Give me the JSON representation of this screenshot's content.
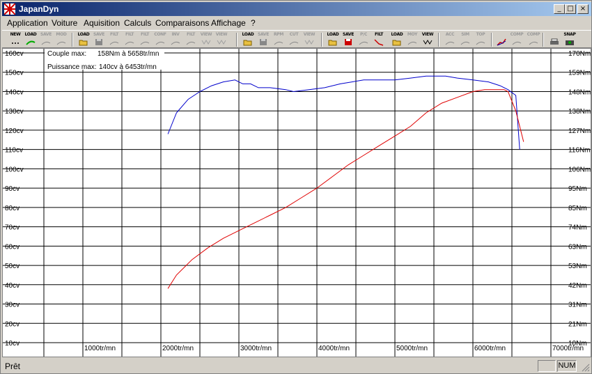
{
  "window": {
    "title": "JapanDyn"
  },
  "title_buttons": {
    "minimize": "_",
    "maximize": "□",
    "close": "×"
  },
  "menu": [
    "Application",
    "Voiture",
    "Aquisition",
    "Calculs",
    "Comparaisons",
    "Affichage",
    "?"
  ],
  "toolbar": [
    {
      "label": "NEW",
      "icon": "dots-icon",
      "enabled": true
    },
    {
      "label": "LOAD",
      "icon": "curve-load-icon",
      "enabled": true
    },
    {
      "label": "SAVE",
      "icon": "curve-save-icon",
      "enabled": false
    },
    {
      "label": "MOD",
      "icon": "curve-mod-icon",
      "enabled": false
    },
    {
      "label": "LOAD",
      "icon": "folder-icon",
      "enabled": true
    },
    {
      "label": "SAVE",
      "icon": "floppy-icon",
      "enabled": false
    },
    {
      "label": "FILT",
      "icon": "filter-off-icon",
      "enabled": false
    },
    {
      "label": "FILT",
      "icon": "filter-plus-icon",
      "enabled": false
    },
    {
      "label": "FILT",
      "icon": "filter-minus-icon",
      "enabled": false
    },
    {
      "label": "CONF",
      "icon": "config-icon",
      "enabled": false
    },
    {
      "label": "INV",
      "icon": "invert-icon",
      "enabled": false
    },
    {
      "label": "FILT",
      "icon": "filter-s-icon",
      "enabled": false
    },
    {
      "label": "VIEW",
      "icon": "view-icon",
      "enabled": false
    },
    {
      "label": "VIEW",
      "icon": "view-icon",
      "enabled": false
    },
    {
      "label": "LOAD",
      "icon": "folder-icon",
      "enabled": true
    },
    {
      "label": "SAVE",
      "icon": "floppy-icon",
      "enabled": false
    },
    {
      "label": "RPM",
      "icon": "rpm-icon",
      "enabled": false
    },
    {
      "label": "CUT",
      "icon": "scissors-icon",
      "enabled": false
    },
    {
      "label": "VIEW",
      "icon": "view-icon",
      "enabled": false
    },
    {
      "label": "LOAD",
      "icon": "folder-icon",
      "enabled": true
    },
    {
      "label": "SAVE",
      "icon": "floppy-red-icon",
      "enabled": true
    },
    {
      "label": "P/C",
      "icon": "pc-icon",
      "enabled": false
    },
    {
      "label": "FILT",
      "icon": "filter-icon",
      "enabled": true
    },
    {
      "label": "LOAD",
      "icon": "folder-icon",
      "enabled": true
    },
    {
      "label": "MOY",
      "icon": "average-icon",
      "enabled": false
    },
    {
      "label": "VIEW",
      "icon": "view-icon",
      "enabled": true
    },
    {
      "label": "ACC",
      "icon": "acc-icon",
      "enabled": false
    },
    {
      "label": "SIM",
      "icon": "sim-icon",
      "enabled": false
    },
    {
      "label": "TOP",
      "icon": "top-icon",
      "enabled": false
    },
    {
      "label": "",
      "icon": "graph-icon",
      "enabled": true
    },
    {
      "label": "COMP",
      "icon": "comp-icon",
      "enabled": false
    },
    {
      "label": "COMP",
      "icon": "comp-icon",
      "enabled": false
    },
    {
      "label": "",
      "icon": "printer-icon",
      "enabled": true
    },
    {
      "label": "SNAP",
      "icon": "camera-icon",
      "enabled": true
    }
  ],
  "plot": {
    "info_torque_label": "Couple max:",
    "info_torque_value": "158Nm à 5658tr/mn",
    "info_power_label": "Puissance max:",
    "info_power_value": "140cv à 6453tr/mn",
    "colors": {
      "power": "#0000cc",
      "torque": "#e00000",
      "grid": "#000000"
    }
  },
  "chart_data": {
    "type": "line",
    "x_range": [
      1000,
      7000
    ],
    "left_axis": {
      "unit": "cv",
      "range": [
        10,
        160
      ],
      "ticks": [
        "10cv",
        "20cv",
        "30cv",
        "40cv",
        "50cv",
        "60cv",
        "70cv",
        "80cv",
        "90cv",
        "100cv",
        "110cv",
        "120cv",
        "130cv",
        "140cv",
        "150cv",
        "160cv"
      ]
    },
    "right_axis": {
      "unit": "Nm",
      "range": [
        10,
        170
      ],
      "ticks": [
        "10Nm",
        "21Nm",
        "31Nm",
        "42Nm",
        "53Nm",
        "63Nm",
        "74Nm",
        "85Nm",
        "95Nm",
        "106Nm",
        "116Nm",
        "127Nm",
        "138Nm",
        "148Nm",
        "159Nm",
        "170Nm"
      ]
    },
    "x_ticks": [
      "1000tr/mn",
      "2000tr/mn",
      "3000tr/mn",
      "4000tr/mn",
      "5000tr/mn",
      "6000tr/mn",
      "7000tr/mn"
    ],
    "series": [
      {
        "key": "power_series",
        "axis": "left",
        "color": "#0000cc",
        "x": [
          2090,
          2200,
          2350,
          2500,
          2650,
          2800,
          2950,
          3050,
          3150,
          3250,
          3400,
          3600,
          3700,
          3900,
          4100,
          4300,
          4450,
          4600,
          4800,
          5000,
          5200,
          5400,
          5500,
          5650,
          5800,
          6000,
          6200,
          6350,
          6450,
          6550,
          6600
        ],
        "y": [
          118,
          129,
          136,
          140,
          143,
          145,
          146,
          144,
          144,
          142,
          142,
          141,
          140,
          141,
          142,
          144,
          145,
          146,
          146,
          146,
          147,
          148,
          148,
          148,
          147,
          146,
          145,
          143,
          141,
          138,
          110
        ]
      },
      {
        "key": "torque_series",
        "axis": "left",
        "color": "#e00000",
        "x": [
          2090,
          2200,
          2400,
          2600,
          2800,
          3000,
          3200,
          3400,
          3600,
          3800,
          4000,
          4200,
          4400,
          4600,
          4800,
          5000,
          5200,
          5400,
          5600,
          5800,
          6000,
          6150,
          6300,
          6400,
          6450,
          6550,
          6650
        ],
        "y": [
          38,
          45,
          53,
          59,
          64,
          68,
          72,
          76,
          80,
          85,
          90,
          96,
          102,
          107,
          112,
          117,
          122,
          129,
          134,
          137,
          140,
          141,
          141,
          141,
          140,
          130,
          114
        ]
      }
    ]
  },
  "status": {
    "text": "Prêt",
    "num": "NUM"
  }
}
